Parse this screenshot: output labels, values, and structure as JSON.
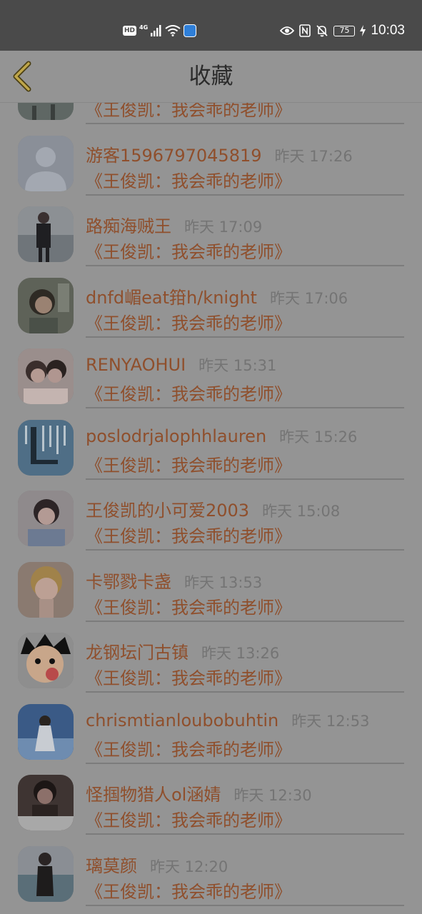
{
  "status_bar": {
    "hd": "HD",
    "network": "4G",
    "battery": "75",
    "time": "10:03"
  },
  "header": {
    "title": "收藏",
    "back_icon": "chevron-left-icon"
  },
  "colors": {
    "name_text": "#8f4f2c",
    "time_text": "#747474",
    "title_text": "#2b2b2b",
    "status_bar_bg": "#4a4a4a",
    "page_bg": "#949494"
  },
  "items": [
    {
      "name": "",
      "time": "",
      "subtitle": "《王俊凯：我会乖的老师》"
    },
    {
      "name": "游客1596797045819",
      "time": "昨天 17:26",
      "subtitle": "《王俊凯：我会乖的老师》"
    },
    {
      "name": "路痴海贼王",
      "time": "昨天 17:09",
      "subtitle": "《王俊凯：我会乖的老师》"
    },
    {
      "name": "dnfd嵋eat箝h/knight",
      "time": "昨天 17:06",
      "subtitle": "《王俊凯：我会乖的老师》"
    },
    {
      "name": "RENYAOHUI",
      "time": "昨天 15:31",
      "subtitle": "《王俊凯：我会乖的老师》"
    },
    {
      "name": "poslodrjalophhlauren",
      "time": "昨天 15:26",
      "subtitle": "《王俊凯：我会乖的老师》"
    },
    {
      "name": "王俊凯的小可爱2003",
      "time": "昨天 15:08",
      "subtitle": "《王俊凯：我会乖的老师》"
    },
    {
      "name": "卡鄂戮卡盏",
      "time": "昨天 13:53",
      "subtitle": "《王俊凯：我会乖的老师》"
    },
    {
      "name": "龙钢坛门古镇",
      "time": "昨天 13:26",
      "subtitle": "《王俊凯：我会乖的老师》"
    },
    {
      "name": "chrismtianloubobuhtin",
      "time": "昨天 12:53",
      "subtitle": "《王俊凯：我会乖的老师》"
    },
    {
      "name": "怪掴物猎人ol涵婧",
      "time": "昨天 12:30",
      "subtitle": "《王俊凯：我会乖的老师》"
    },
    {
      "name": "璃莫颜",
      "time": "昨天 12:20",
      "subtitle": "《王俊凯：我会乖的老师》"
    }
  ]
}
